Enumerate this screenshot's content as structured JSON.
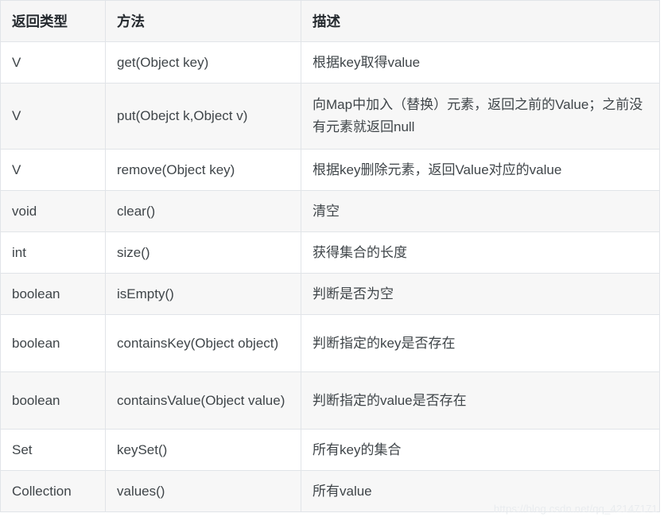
{
  "table": {
    "columns": [
      "返回类型",
      "方法",
      "描述"
    ],
    "rows": [
      {
        "return_type": "V",
        "method": "get(Object key)",
        "description": "根据key取得value"
      },
      {
        "return_type": "V",
        "method": "put(Obejct k,Object v)",
        "description": "向Map中加入（替换）元素，返回之前的Value；之前没有元素就返回null"
      },
      {
        "return_type": "V",
        "method": "remove(Object key)",
        "description": "根据key删除元素，返回Value对应的value"
      },
      {
        "return_type": "void",
        "method": "clear()",
        "description": "清空"
      },
      {
        "return_type": "int",
        "method": "size()",
        "description": "获得集合的长度"
      },
      {
        "return_type": "boolean",
        "method": "isEmpty()",
        "description": "判断是否为空"
      },
      {
        "return_type": "boolean",
        "method": "containsKey(Object object)",
        "description": "判断指定的key是否存在"
      },
      {
        "return_type": "boolean",
        "method": "containsValue(Object value)",
        "description": "判断指定的value是否存在"
      },
      {
        "return_type": "Set",
        "method": "keySet()",
        "description": "所有key的集合"
      },
      {
        "return_type": "Collection",
        "method": "values()",
        "description": "所有value"
      }
    ]
  },
  "watermark": {
    "text": "https://blog.csdn.net/qq_42147171"
  },
  "colors": {
    "header_background": "#f6f6f6",
    "row_shade_background": "#f7f7f7",
    "row_plain_background": "#ffffff",
    "border": "#e1e4e8",
    "header_text": "#24292e",
    "body_text": "#3f4549",
    "watermark_text": "#e9ecef"
  }
}
